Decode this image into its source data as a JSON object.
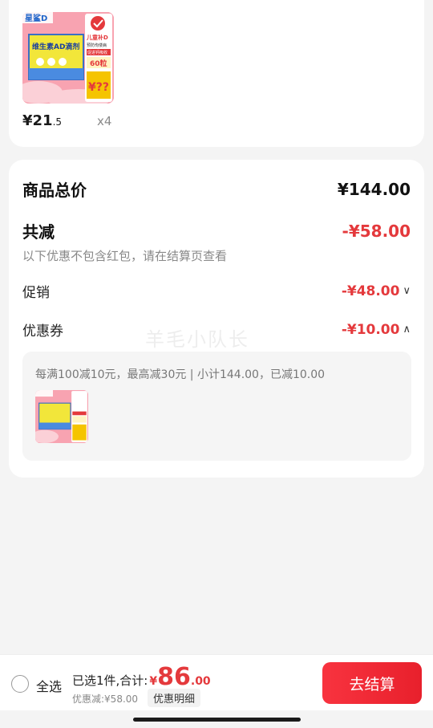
{
  "product": {
    "brand": "星鲨D",
    "box_title": "维生素AD滴剂",
    "badge_line1": "儿童补D",
    "badge_line2": "预防佝偻病",
    "badge_line3": "促进钙吸收",
    "pack": "60粒",
    "promo": "¥??",
    "price_main": "¥21",
    "price_decimal": ".5",
    "quantity": "x4"
  },
  "summary": {
    "total_label": "商品总价",
    "total_value": "¥144.00",
    "reduce_label": "共减",
    "reduce_value": "-¥58.00",
    "hint": "以下优惠不包含红包，请在结算页查看",
    "promo_label": "促销",
    "promo_value": "-¥48.00",
    "coupon_label": "优惠券",
    "coupon_value": "-¥10.00",
    "coupon_desc": "每满100减10元，最高减30元 | 小计144.00，已减10.00"
  },
  "watermark": "羊毛小队长",
  "bottom": {
    "select_all": "全选",
    "selected_text": "已选1件,合计:",
    "currency": "¥",
    "amount_int": "86",
    "amount_dec": ".00",
    "saved_text": "优惠减:¥58.00",
    "detail_label": "优惠明细",
    "checkout_label": "去结算"
  },
  "colors": {
    "accent_red": "#e4393c",
    "button_red": "#f22f3c",
    "background": "#f4f4f4"
  }
}
